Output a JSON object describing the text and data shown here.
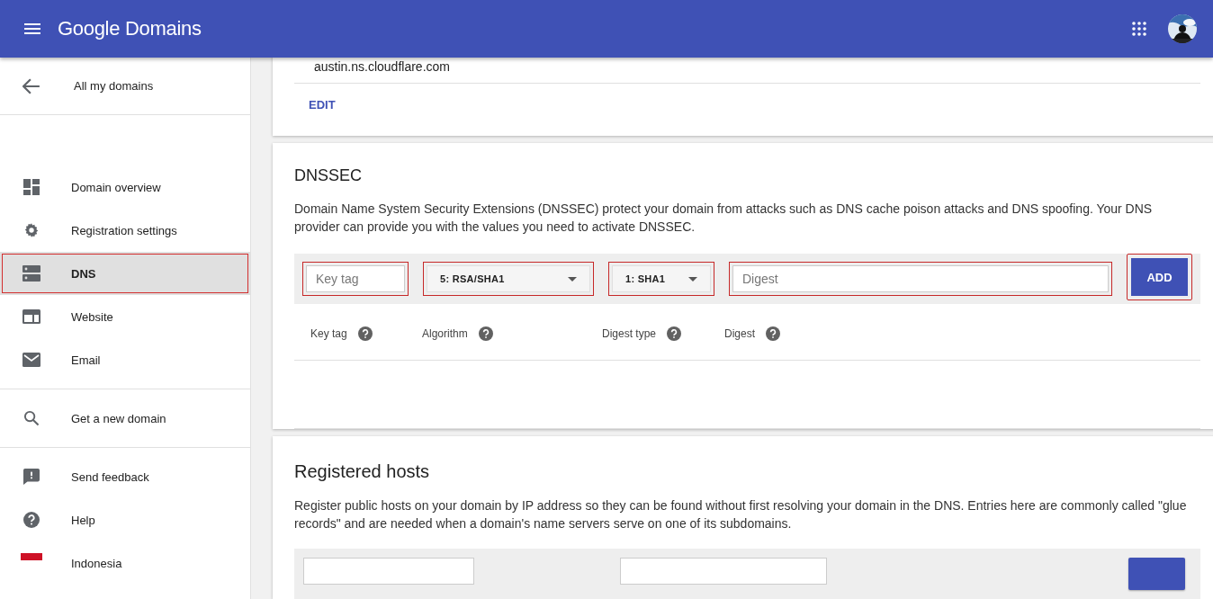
{
  "app_bar": {
    "brand": "Google Domains"
  },
  "sidebar": {
    "back": {
      "label": "All my domains"
    },
    "groups": [
      [
        {
          "label": "Domain overview",
          "selected": false,
          "outlined": false
        },
        {
          "label": "Registration settings",
          "selected": false,
          "outlined": false
        },
        {
          "label": "DNS",
          "selected": true,
          "outlined": true
        },
        {
          "label": "Website",
          "selected": false,
          "outlined": false
        },
        {
          "label": "Email",
          "selected": false,
          "outlined": false
        }
      ],
      [
        {
          "label": "Get a new domain",
          "selected": false,
          "outlined": false
        }
      ],
      [
        {
          "label": "Send feedback",
          "selected": false,
          "outlined": false
        },
        {
          "label": "Help",
          "selected": false,
          "outlined": false
        },
        {
          "label": "Indonesia",
          "selected": false,
          "outlined": false
        }
      ]
    ]
  },
  "name_servers": {
    "server": "austin.ns.cloudflare.com",
    "edit": "EDIT"
  },
  "dnssec": {
    "title": "DNSSEC",
    "description": "Domain Name System Security Extensions (DNSSEC) protect your domain from attacks such as DNS cache poison attacks and DNS spoofing. Your DNS provider can provide you with the values you need to activate DNSSEC.",
    "form": [
      {
        "kind": "input",
        "placeholder": "Key tag",
        "outlined": true
      },
      {
        "kind": "select",
        "value": "5: RSA/SHA1",
        "outlined": true
      },
      {
        "kind": "select",
        "value": "1: SHA1",
        "outlined": true
      },
      {
        "kind": "input",
        "placeholder": "Digest",
        "outlined": true
      },
      {
        "kind": "button",
        "label": "ADD",
        "outlined": true
      }
    ],
    "columns": [
      "Key tag",
      "Algorithm",
      "Digest type",
      "Digest"
    ]
  },
  "registered_hosts": {
    "title": "Registered hosts",
    "description": "Register public hosts on your domain by IP address so they can be found without first resolving your domain in the DNS. Entries here are commonly called \"glue records\" and are needed when a domain's name servers serve on one of its subdomains."
  }
}
